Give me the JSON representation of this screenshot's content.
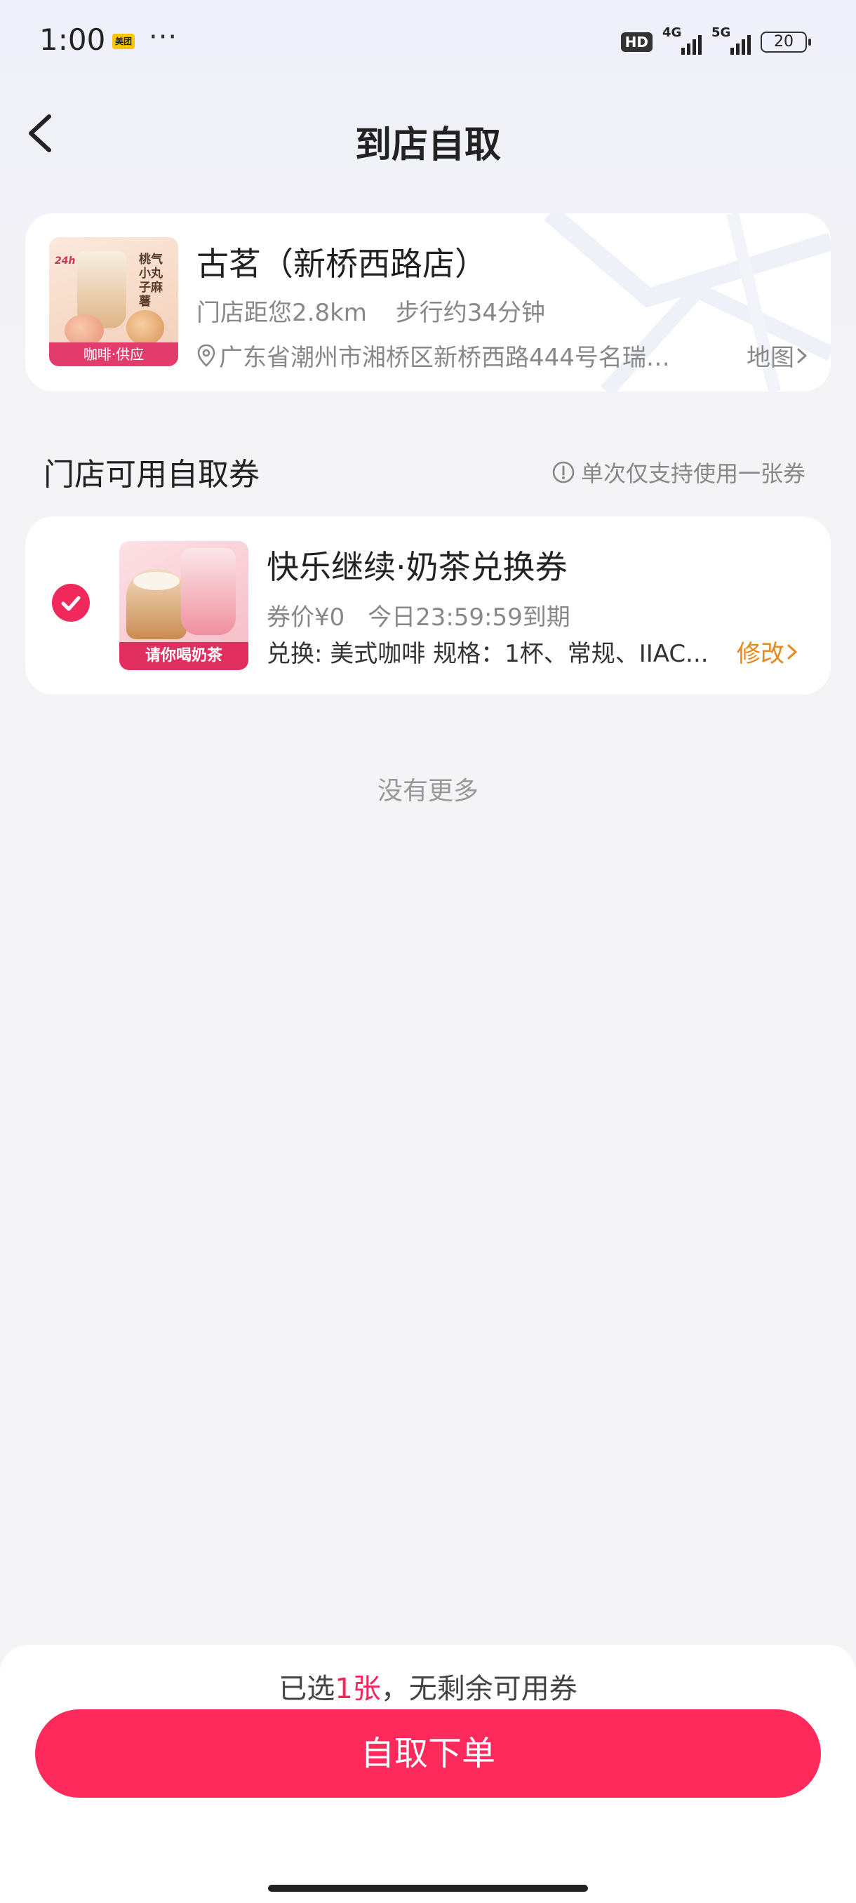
{
  "status_bar": {
    "time": "1:00",
    "app_badge": "美团",
    "more": "···",
    "hd": "HD",
    "net1": "4G",
    "net2": "5G",
    "battery": "20"
  },
  "header": {
    "title": "到店自取",
    "back_icon": "chevron-left-icon"
  },
  "store": {
    "image_strip": "咖啡·供应",
    "image_badge": "24h",
    "image_side_text": "桃气小丸子麻薯",
    "name": "古茗（新桥西路店）",
    "distance": "门店距您2.8km",
    "walk": "步行约34分钟",
    "address": "广东省潮州市湘桥区新桥西路444号名瑞…",
    "map_link": "地图"
  },
  "coupons_section": {
    "title": "门店可用自取券",
    "note": "单次仅支持使用一张券"
  },
  "coupon": {
    "selected": true,
    "image_strip": "请你喝奶茶",
    "name": "快乐继续·奶茶兑换券",
    "price": "券价¥0",
    "expiry": "今日23:59:59到期",
    "spec": "兑换: 美式咖啡  规格：1杯、常规、IIAC...",
    "edit_label": "修改"
  },
  "list_end": "没有更多",
  "bottom": {
    "summary_prefix": "已选",
    "summary_count": "1张",
    "summary_suffix": "，无剩余可用券",
    "submit_label": "自取下单"
  },
  "colors": {
    "accent": "#fe2a5c",
    "edit": "#e8871b",
    "muted_text": "#888888"
  }
}
